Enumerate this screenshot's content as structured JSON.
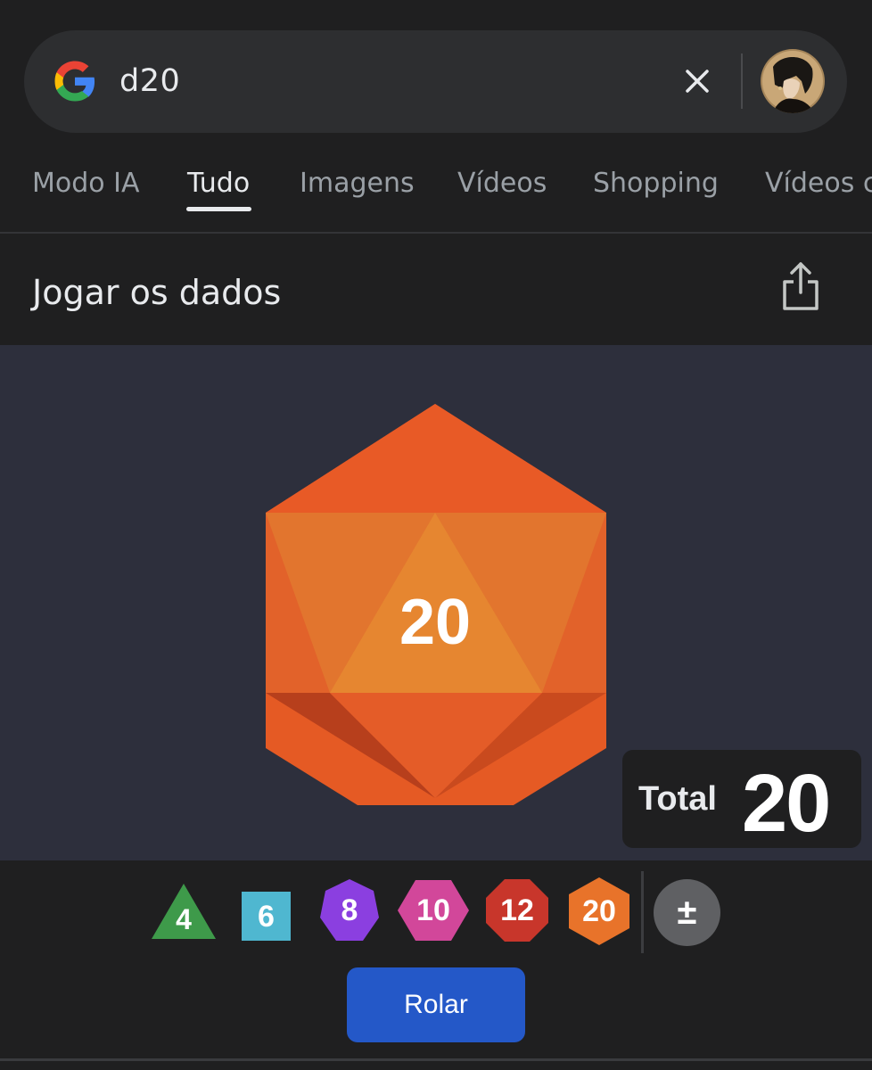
{
  "search": {
    "query": "d20",
    "clear_icon": "close-icon",
    "logo": "google-g-logo"
  },
  "tabs": [
    {
      "label": "Modo IA",
      "active": false
    },
    {
      "label": "Tudo",
      "active": true
    },
    {
      "label": "Imagens",
      "active": false
    },
    {
      "label": "Vídeos",
      "active": false
    },
    {
      "label": "Shopping",
      "active": false
    },
    {
      "label": "Vídeos c",
      "active": false
    }
  ],
  "card": {
    "title": "Jogar os dados",
    "share_icon": "share-icon"
  },
  "roll": {
    "die_value": "20",
    "die_color": "#e8582a",
    "total_label": "Total",
    "total_value": "20"
  },
  "dice": [
    {
      "label": "4",
      "shape": "triangle-icon",
      "color": "#3e9a4a"
    },
    {
      "label": "6",
      "shape": "square-icon",
      "color": "#4fb7d0"
    },
    {
      "label": "8",
      "shape": "heptagon-icon",
      "color": "#8b3fe0"
    },
    {
      "label": "10",
      "shape": "hexagon-icon",
      "color": "#d2479a"
    },
    {
      "label": "12",
      "shape": "octagon-icon",
      "color": "#c8362b"
    },
    {
      "label": "20",
      "shape": "hexagon-icon",
      "color": "#e8732a"
    }
  ],
  "modifier_label": "±",
  "roll_button": "Rolar"
}
